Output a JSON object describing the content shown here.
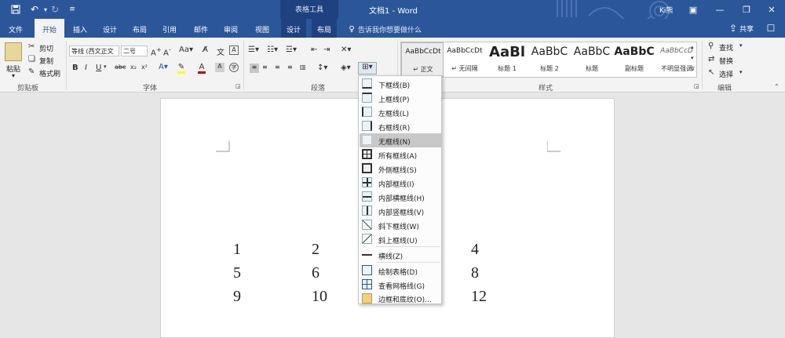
{
  "titlebar": {
    "doc_title": "文档1 - Word",
    "context_title": "表格工具",
    "user_label": "Ki熊",
    "icons": [
      "save-icon",
      "undo-icon",
      "redo-icon",
      "customize-icon"
    ]
  },
  "tabs": [
    {
      "label": "文件"
    },
    {
      "label": "开始"
    },
    {
      "label": "插入"
    },
    {
      "label": "设计"
    },
    {
      "label": "布局"
    },
    {
      "label": "引用"
    },
    {
      "label": "邮件"
    },
    {
      "label": "审阅"
    },
    {
      "label": "视图"
    },
    {
      "label": "设计"
    },
    {
      "label": "布局"
    }
  ],
  "tell_me": "告诉我你想要做什么",
  "share_label": "共享",
  "clipboard": {
    "paste": "粘贴",
    "cut": "剪切",
    "copy": "复制",
    "format_painter": "格式刷",
    "group": "剪贴板"
  },
  "font": {
    "name": "等线 (西文正文",
    "size": "二号",
    "group": "字体"
  },
  "paragraph": {
    "group": "段落"
  },
  "styles": {
    "group": "样式",
    "items": [
      {
        "sample": "AaBbCcDt",
        "name": "↵ 正文"
      },
      {
        "sample": "AaBbCcDt",
        "name": "↵ 无间隔"
      },
      {
        "sample": "AaBl",
        "name": "标题 1"
      },
      {
        "sample": "AaBbC",
        "name": "标题 2"
      },
      {
        "sample": "AaBbC",
        "name": "标题"
      },
      {
        "sample": "AaBbC",
        "name": "副标题"
      },
      {
        "sample": "AaBbCcD",
        "name": "不明显强调"
      }
    ]
  },
  "editing": {
    "find": "查找",
    "replace": "替换",
    "select": "选择",
    "group": "编辑"
  },
  "border_menu": {
    "items": [
      {
        "label": "下框线(B)"
      },
      {
        "label": "上框线(P)"
      },
      {
        "label": "左框线(L)"
      },
      {
        "label": "右框线(R)"
      },
      {
        "label": "无框线(N)"
      },
      {
        "label": "所有框线(A)"
      },
      {
        "label": "外侧框线(S)"
      },
      {
        "label": "内部框线(I)"
      },
      {
        "label": "内部横框线(H)"
      },
      {
        "label": "内部竖框线(V)"
      },
      {
        "label": "斜下框线(W)"
      },
      {
        "label": "斜上框线(U)"
      },
      {
        "label": "横线(Z)"
      },
      {
        "label": "绘制表格(D)"
      },
      {
        "label": "查看网格线(G)"
      },
      {
        "label": "边框和底纹(O)..."
      }
    ],
    "highlighted": "无框线(N)"
  },
  "table": {
    "rows": [
      [
        "1",
        "2",
        "4"
      ],
      [
        "5",
        "6",
        "8"
      ],
      [
        "9",
        "10",
        "12"
      ]
    ]
  },
  "colors": {
    "accent": "#2b579a",
    "font_color": "#c00000",
    "highlight": "#ffff00"
  }
}
